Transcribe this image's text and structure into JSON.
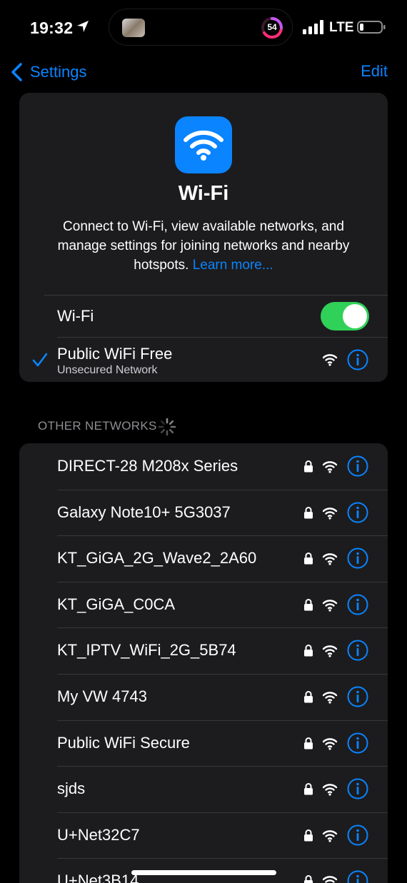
{
  "status_bar": {
    "time": "19:32",
    "carrier": "LTE",
    "island_count": "54"
  },
  "nav": {
    "back_label": "Settings",
    "edit_label": "Edit"
  },
  "header": {
    "title": "Wi-Fi",
    "description": "Connect to Wi-Fi, view available networks, and manage settings for joining networks and nearby hotspots.",
    "learn_more": "Learn more...",
    "wifi_label": "Wi-Fi",
    "wifi_enabled": true,
    "connected_name": "Public WiFi Free",
    "connected_sub": "Unsecured Network"
  },
  "other_networks": {
    "label": "OTHER NETWORKS",
    "items": [
      {
        "name": "DIRECT-28 M208x Series",
        "locked": true
      },
      {
        "name": "Galaxy Note10+ 5G3037",
        "locked": true
      },
      {
        "name": "KT_GiGA_2G_Wave2_2A60",
        "locked": true
      },
      {
        "name": "KT_GiGA_C0CA",
        "locked": true
      },
      {
        "name": "KT_IPTV_WiFi_2G_5B74",
        "locked": true
      },
      {
        "name": "My VW 4743",
        "locked": true
      },
      {
        "name": "Public WiFi Secure",
        "locked": true
      },
      {
        "name": "sjds",
        "locked": true
      },
      {
        "name": "U+Net32C7",
        "locked": true
      },
      {
        "name": "U+Net3B14",
        "locked": true
      }
    ]
  },
  "colors": {
    "accent": "#0a84ff",
    "toggle_on": "#30d158",
    "card_bg": "#1c1c1e"
  }
}
